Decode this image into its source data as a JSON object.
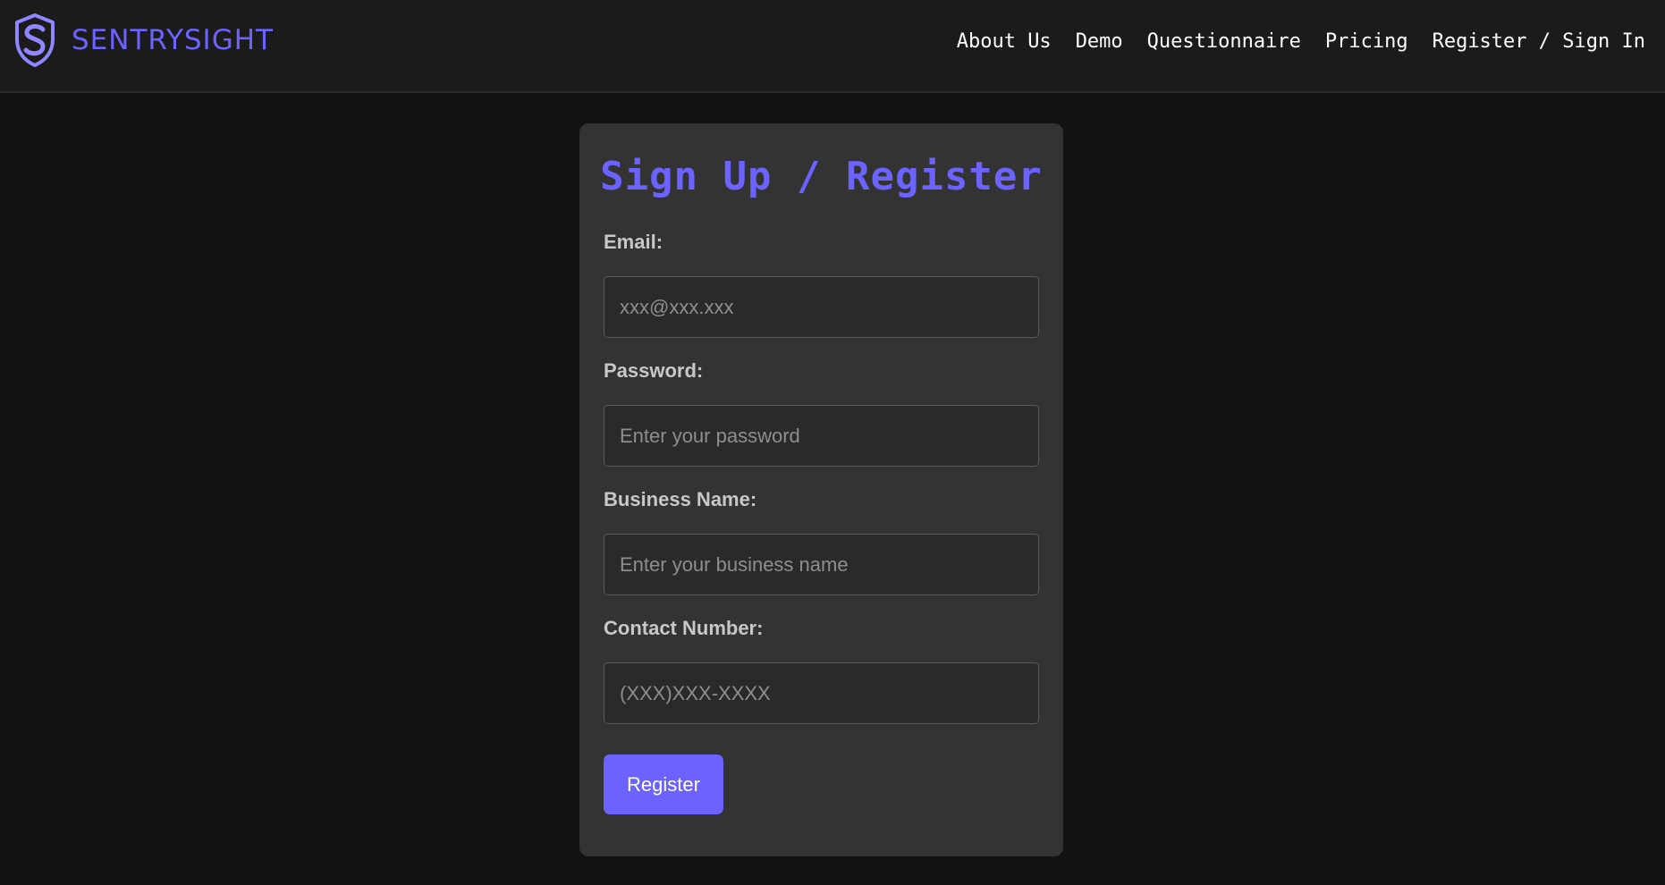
{
  "brand": {
    "name": "SENTRYSIGHT",
    "logo_icon": "shield-s-logo-icon",
    "color": "#6c63ff"
  },
  "nav": {
    "items": [
      {
        "label": "About Us"
      },
      {
        "label": "Demo"
      },
      {
        "label": "Questionnaire"
      },
      {
        "label": "Pricing"
      },
      {
        "label": "Register / Sign In"
      }
    ]
  },
  "form": {
    "title": "Sign Up / Register",
    "fields": {
      "email": {
        "label": "Email:",
        "placeholder": "xxx@xxx.xxx",
        "value": ""
      },
      "password": {
        "label": "Password:",
        "placeholder": "Enter your password",
        "value": ""
      },
      "business_name": {
        "label": "Business Name:",
        "placeholder": "Enter your business name",
        "value": ""
      },
      "contact_number": {
        "label": "Contact Number:",
        "placeholder": "(XXX)XXX-XXXX",
        "value": ""
      }
    },
    "submit_label": "Register"
  },
  "colors": {
    "accent": "#6c63ff",
    "page_background": "#121212",
    "navbar_background": "#1b1b1b",
    "card_background": "#333333",
    "input_background": "#2a2a2a"
  }
}
